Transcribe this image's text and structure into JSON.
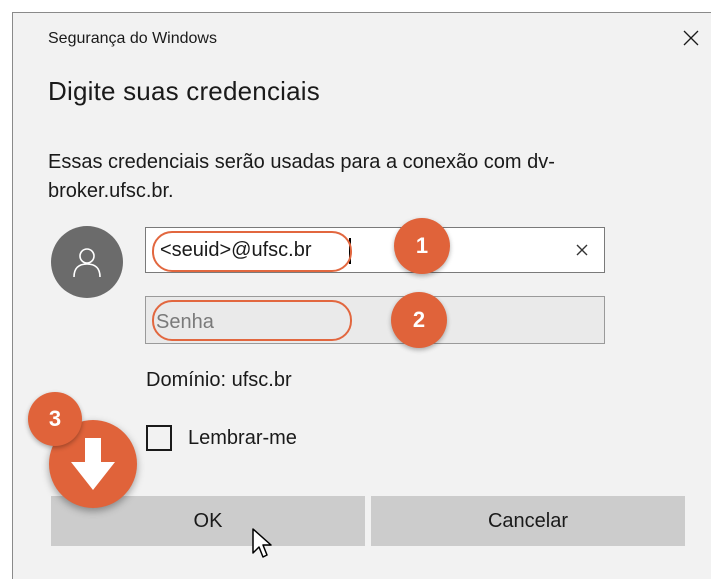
{
  "dialog": {
    "window_title": "Segurança do Windows",
    "heading": "Digite suas credenciais",
    "description": "Essas credenciais serão usadas para a conexão com dv-broker.ufsc.br.",
    "username": {
      "value": "<seuid>@ufsc.br"
    },
    "password": {
      "placeholder": "Senha"
    },
    "domain_text": "Domínio: ufsc.br",
    "remember_label": "Lembrar-me",
    "ok_label": "OK",
    "cancel_label": "Cancelar"
  },
  "annotations": {
    "step1": "1",
    "step2": "2",
    "step3": "3",
    "accent_color": "#e0633a"
  },
  "icons": [
    "close-icon",
    "user-icon",
    "clear-icon",
    "down-arrow-icon",
    "mouse-pointer-icon"
  ]
}
